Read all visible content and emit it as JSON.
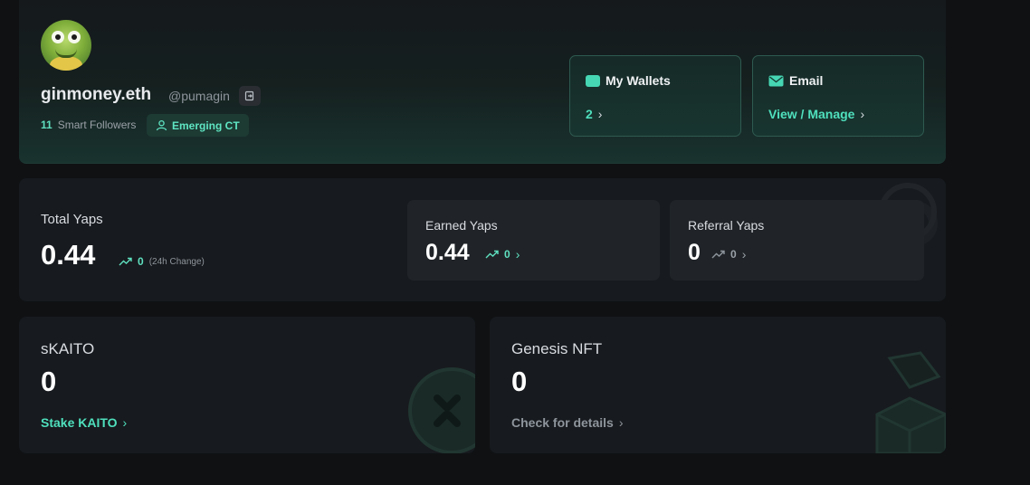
{
  "profile": {
    "name": "ginmoney.eth",
    "handle": "@pumagin",
    "smart_followers_count": "11",
    "smart_followers_label": "Smart Followers",
    "badge_label": "Emerging CT"
  },
  "wallets": {
    "title": "My Wallets",
    "count": "2"
  },
  "email": {
    "title": "Email",
    "link": "View / Manage"
  },
  "total_yaps": {
    "label": "Total Yaps",
    "value": "0.44",
    "change": "0",
    "change_note": "(24h Change)"
  },
  "earned_yaps": {
    "label": "Earned Yaps",
    "value": "0.44",
    "change": "0"
  },
  "referral_yaps": {
    "label": "Referral Yaps",
    "value": "0",
    "change": "0"
  },
  "skaito": {
    "label": "sKAITO",
    "value": "0",
    "action": "Stake KAITO"
  },
  "genesis_nft": {
    "label": "Genesis NFT",
    "value": "0",
    "action": "Check for details"
  },
  "colors": {
    "accent": "#4fe0bd",
    "background": "#0f1113",
    "card": "#171a1e"
  }
}
